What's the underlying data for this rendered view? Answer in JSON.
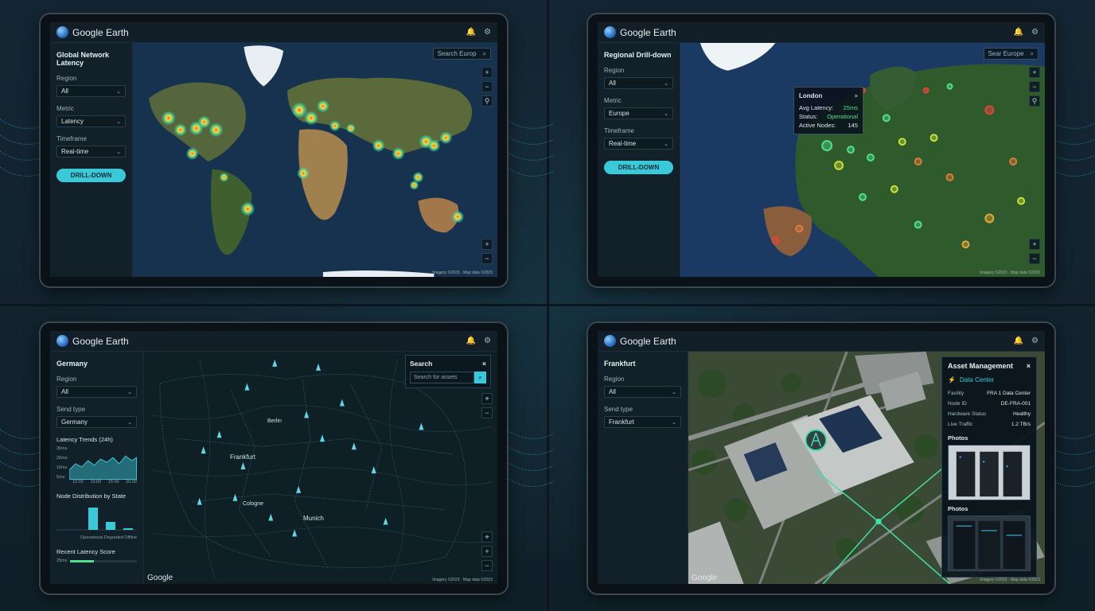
{
  "app": {
    "name": "Google Earth"
  },
  "panels": {
    "global": {
      "title": "Global Network Latency",
      "fields": [
        {
          "label": "Region",
          "value": "All"
        },
        {
          "label": "Metric",
          "value": "Latency"
        },
        {
          "label": "Timeframe",
          "value": "Real-time"
        }
      ],
      "button": "DRILL-DOWN",
      "search_placeholder": "Search Europ",
      "attribution": "Imagery ©2023 · Map data ©2023"
    },
    "regional": {
      "title": "Regional Drill-down",
      "fields": [
        {
          "label": "Region",
          "value": "All"
        },
        {
          "label": "Metric",
          "value": "Europe"
        },
        {
          "label": "Timeframe",
          "value": "Real-time"
        }
      ],
      "button": "DRILL-DOWN",
      "search_placeholder": "Sear Europe",
      "popup": {
        "title": "London",
        "rows": [
          {
            "k": "Avg Latency:",
            "v": "25ms"
          },
          {
            "k": "Status:",
            "v": "Operational"
          },
          {
            "k": "Active Nodes:",
            "v": "145"
          }
        ]
      },
      "attribution": "Imagery ©2023 · Map data ©2023"
    },
    "germany": {
      "title": "Germany",
      "fields": [
        {
          "label": "Region",
          "value": "All"
        },
        {
          "label": "Send type",
          "value": "Germany"
        }
      ],
      "search_title": "Search",
      "search_placeholder": "Search for assets",
      "latency_title": "Latency Trends (24h)",
      "latency_yticks": [
        "30ms",
        "20ms",
        "10ms",
        "5ms"
      ],
      "latency_xticks": [
        "10:00",
        "15:00",
        "15:00",
        "20:00"
      ],
      "dist_title": "Node Distribution by State",
      "dist_xlabels": [
        "Operational",
        "Degraded",
        "Offline"
      ],
      "recent_title": "Recent Latency Score",
      "recent_value": "25ms",
      "cities": [
        "Frankfurt",
        "Berlin",
        "Cologne",
        "Munich"
      ],
      "google_label": "Google",
      "attribution": "Imagery ©2023 · Map data ©2023"
    },
    "frankfurt": {
      "title": "Frankfurt",
      "fields": [
        {
          "label": "Region",
          "value": "All"
        },
        {
          "label": "Send type",
          "value": "Frankfurt"
        }
      ],
      "asset": {
        "title": "Asset Management",
        "type": "Data Center",
        "rows": [
          {
            "k": "Facility",
            "v": "FRA 1 Data Center"
          },
          {
            "k": "Node ID",
            "v": "DE-FRA-001"
          },
          {
            "k": "Hardware Status",
            "v": "Healthy"
          },
          {
            "k": "Live Traffic",
            "v": "1.2 TB/s"
          }
        ],
        "photos_label_1": "Photos",
        "photos_label_2": "Photos"
      },
      "google_label": "Google",
      "attribution": "Imagery ©2023 · Map data ©2023"
    }
  },
  "colors": {
    "accent": "#39c9d9",
    "ok": "#4fe08b"
  }
}
